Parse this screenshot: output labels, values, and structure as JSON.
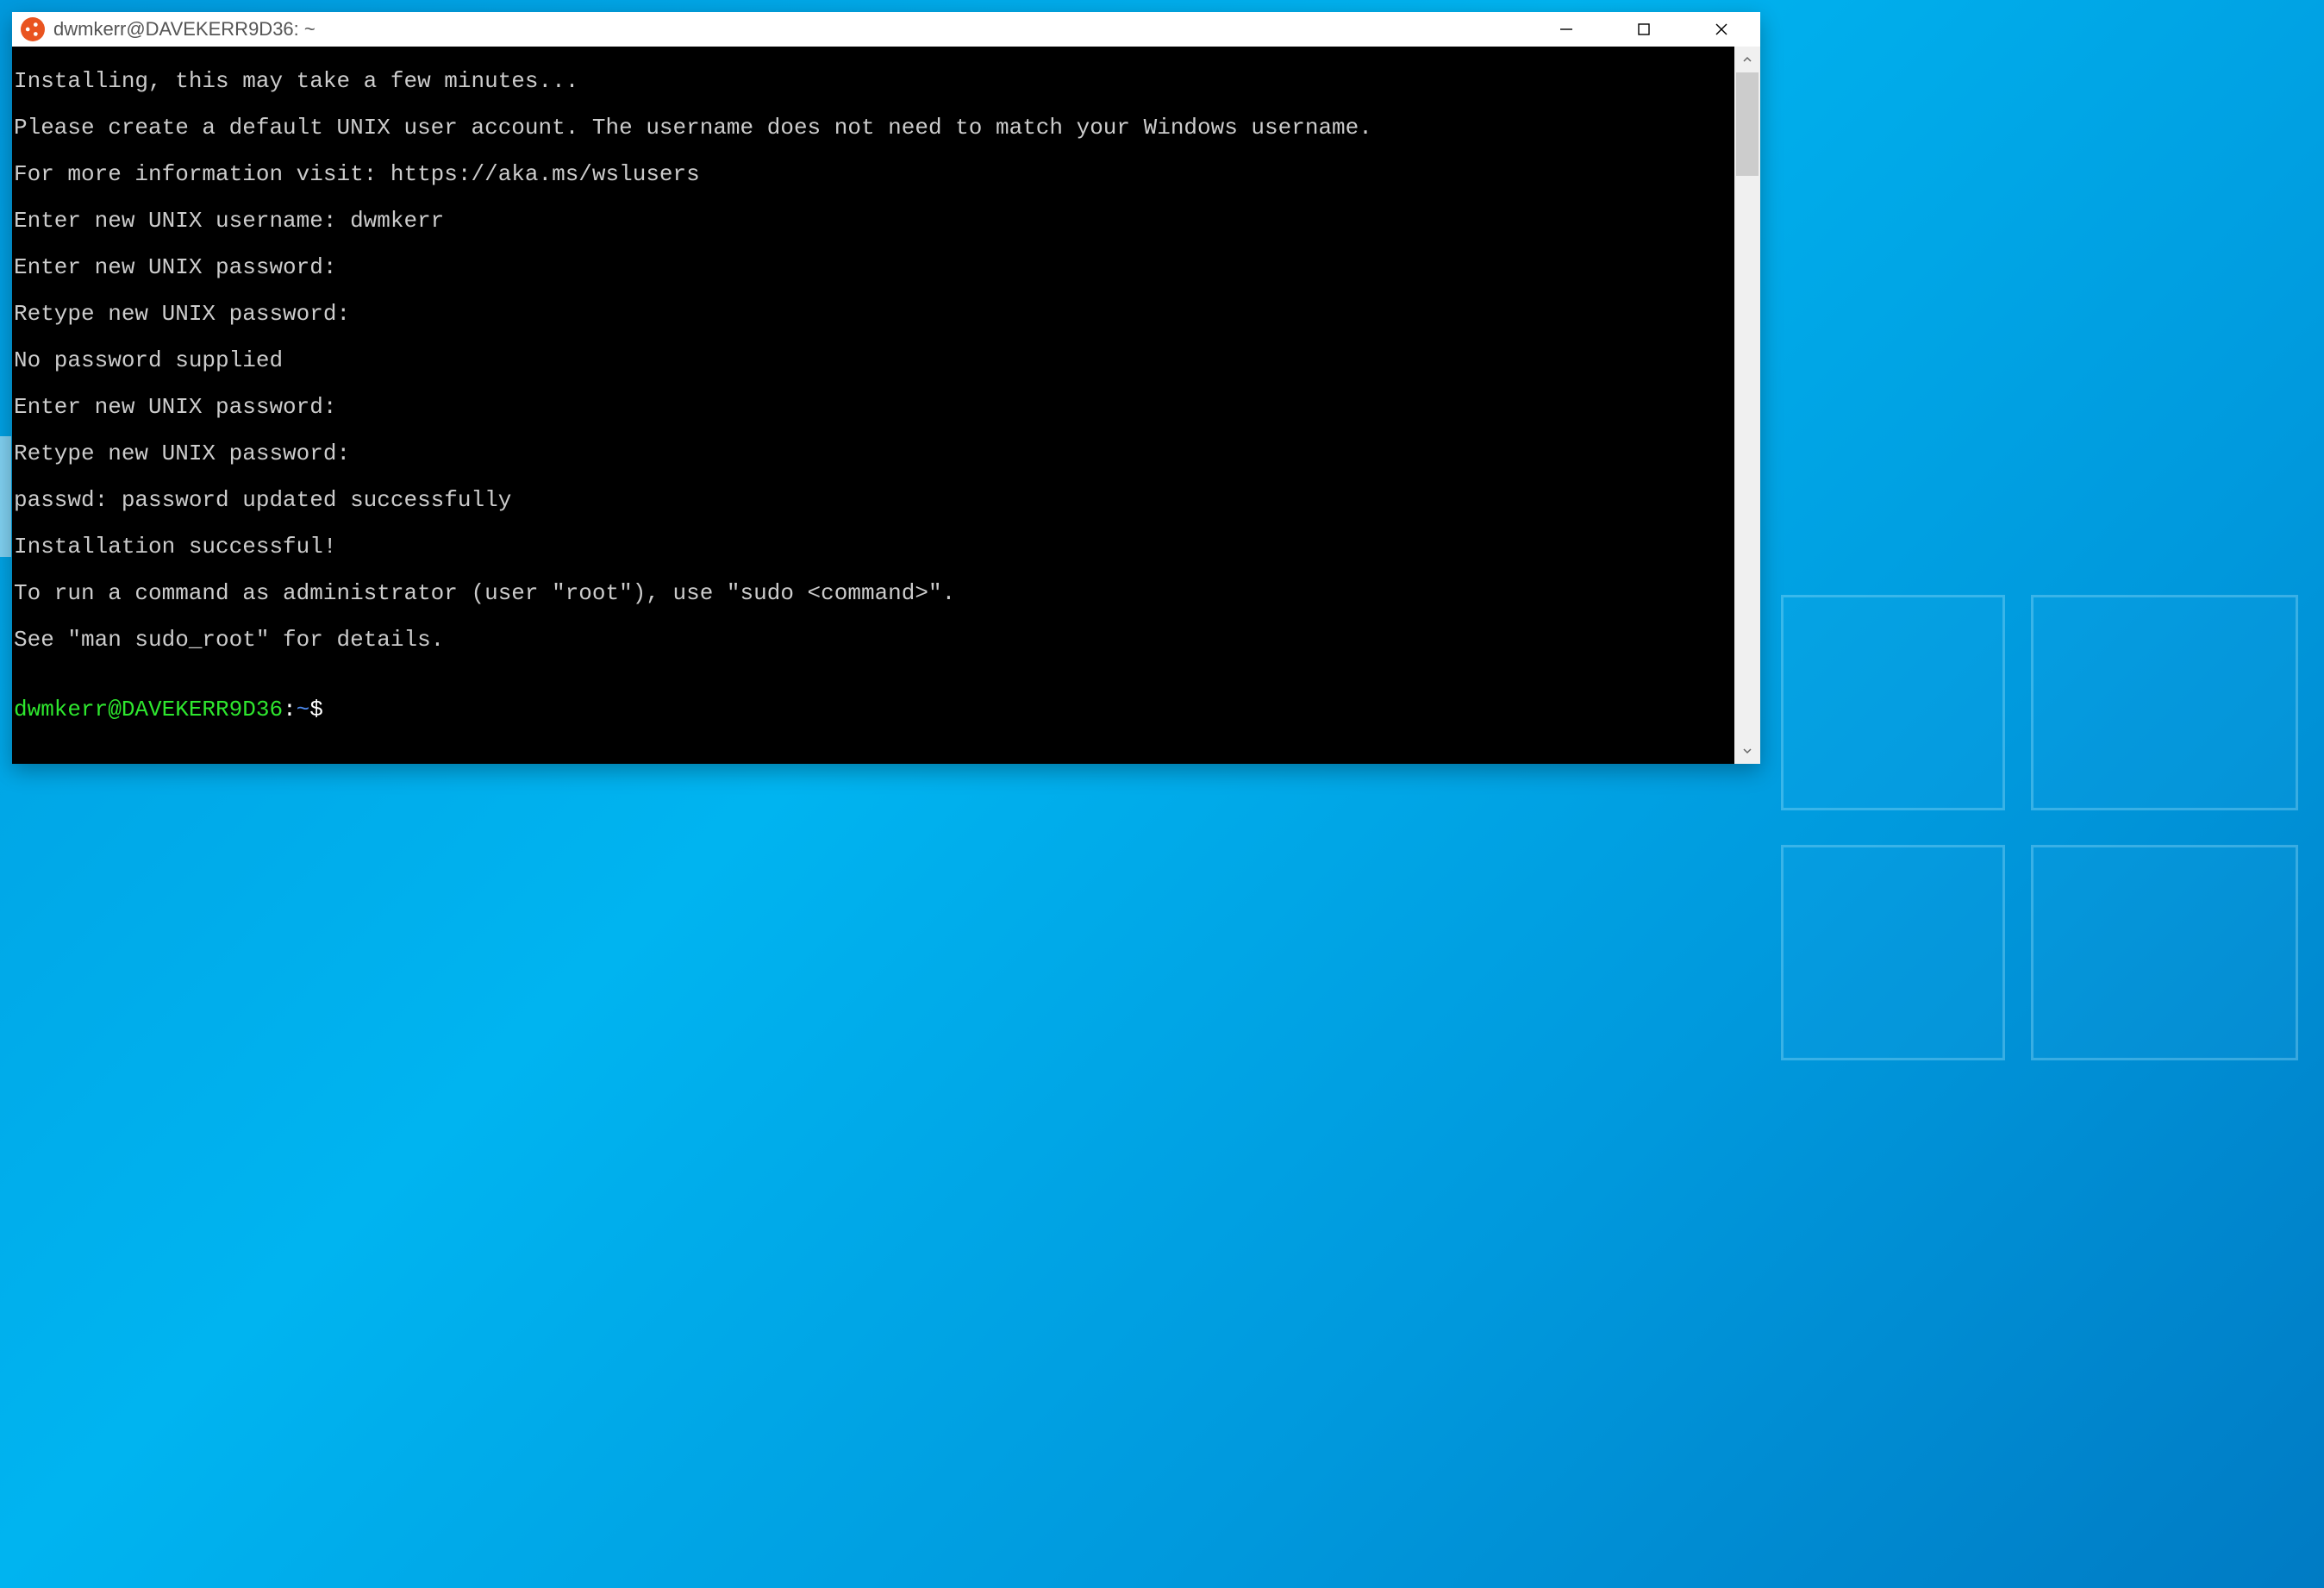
{
  "window": {
    "title": "dwmkerr@DAVEKERR9D36: ~",
    "icon_name": "ubuntu-icon"
  },
  "terminal": {
    "lines": [
      "Installing, this may take a few minutes...",
      "Please create a default UNIX user account. The username does not need to match your Windows username.",
      "For more information visit: https://aka.ms/wslusers",
      "Enter new UNIX username: dwmkerr",
      "Enter new UNIX password:",
      "Retype new UNIX password:",
      "No password supplied",
      "Enter new UNIX password:",
      "Retype new UNIX password:",
      "passwd: password updated successfully",
      "Installation successful!",
      "To run a command as administrator (user \"root\"), use \"sudo <command>\".",
      "See \"man sudo_root\" for details.",
      ""
    ],
    "prompt": {
      "user_host": "dwmkerr@DAVEKERR9D36",
      "colon": ":",
      "path": "~",
      "symbol": "$"
    }
  },
  "colors": {
    "desktop_gradient_top": "#00b4f0",
    "desktop_gradient_bottom": "#007bc4",
    "ubuntu_orange": "#e95420",
    "prompt_green": "#2ee62e",
    "prompt_blue": "#4d8bf0"
  }
}
